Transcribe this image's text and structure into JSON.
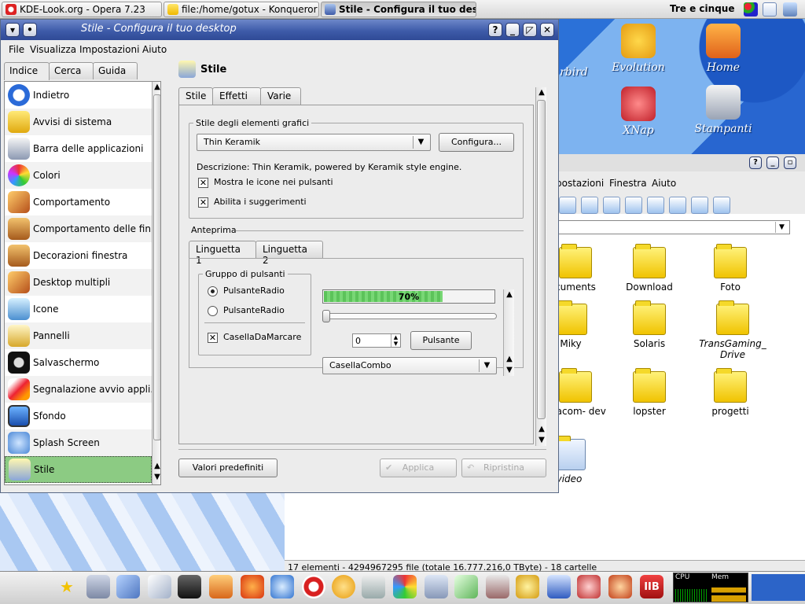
{
  "taskbar": {
    "tasks": [
      "KDE-Look.org - Opera 7.23",
      "file:/home/gotux - Konqueror",
      "Stile - Configura il tuo deskto"
    ],
    "clock": "Tre e cinque"
  },
  "desktop": {
    "icons": [
      "rbird",
      "Evolution",
      "Home",
      "XNap",
      "Stampanti"
    ]
  },
  "konqueror": {
    "menu": [
      "postazioni",
      "Finestra",
      "Aiuto"
    ],
    "folders": [
      "cuments",
      "Download",
      "Foto",
      "Miky",
      "Solaris",
      "TransGaming_ Drive",
      "twacom- dev",
      "lopster",
      "progetti",
      "video"
    ],
    "status": "17 elementi - 4294967295 file (totale 16.777.216,0 TByte) - 18 cartelle"
  },
  "window": {
    "title": "Stile - Configura il tuo desktop",
    "menu": [
      "File",
      "Visualizza",
      "Impostazioni",
      "Aiuto"
    ],
    "left_tabs": [
      "Indice",
      "Cerca",
      "Guida"
    ],
    "nav_items": [
      "Indietro",
      "Avvisi di sistema",
      "Barra delle applicazioni",
      "Colori",
      "Comportamento",
      "Comportamento delle fin...",
      "Decorazioni finestra",
      "Desktop multipli",
      "Icone",
      "Pannelli",
      "Salvaschermo",
      "Segnalazione avvio appli...",
      "Sfondo",
      "Splash Screen",
      "Stile"
    ],
    "selected_nav": "Stile",
    "module_title": "Stile",
    "tabs": [
      "Stile",
      "Effetti",
      "Varie"
    ],
    "widget_group": {
      "title": "Stile degli elementi grafici",
      "combo_value": "Thin Keramik",
      "configure_button": "Configura...",
      "description": "Descrizione: Thin Keramik, powered by Keramik style engine.",
      "check_icons": "Mostra le icone nei pulsanti",
      "check_tooltips": "Abilita i suggerimenti"
    },
    "preview": {
      "title": "Anteprima",
      "tabs": [
        "Linguetta 1",
        "Linguetta 2"
      ],
      "button_group": "Gruppo di pulsanti",
      "radio1": "PulsanteRadio",
      "radio2": "PulsanteRadio",
      "checkbox": "CasellaDaMarcare",
      "progress": 0.7,
      "progress_label": "70%",
      "spin_value": "0",
      "push_button": "Pulsante",
      "combo": "CasellaCombo"
    },
    "buttons": {
      "defaults": "Valori predefiniti",
      "apply": "Applica",
      "reset": "Ripristina"
    }
  },
  "colors": {
    "titlebar": "#3e5ba9",
    "selected_item": "#8ccb83",
    "progress": "#5cc35a"
  }
}
